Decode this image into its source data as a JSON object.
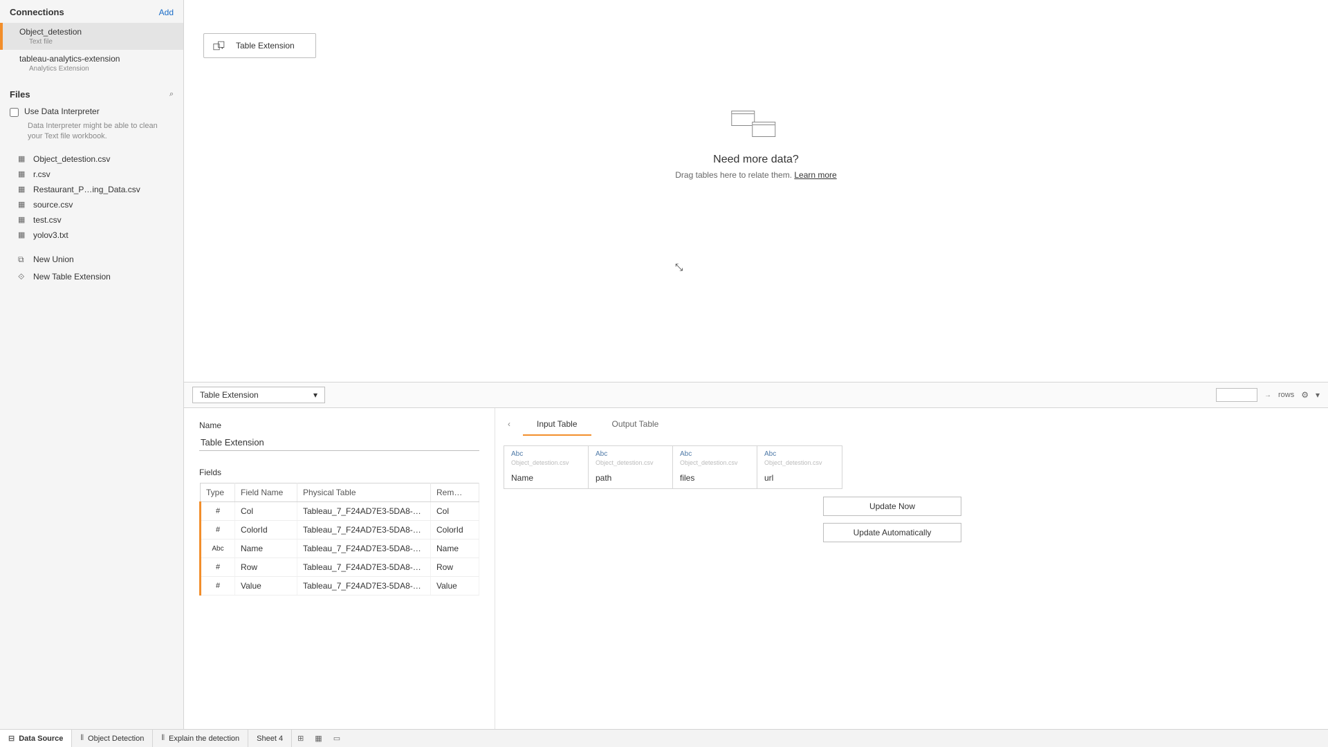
{
  "sidebar": {
    "title": "Connections",
    "add_label": "Add",
    "connections": [
      {
        "name": "Object_detestion",
        "sub": "Text file",
        "active": true
      },
      {
        "name": "tableau-analytics-extension",
        "sub": "Analytics Extension",
        "active": false
      }
    ],
    "files_title": "Files",
    "search_icon_glyph": "⌕",
    "di_label": "Use Data Interpreter",
    "di_hint": "Data Interpreter might be able to clean your Text file workbook.",
    "files": [
      "Object_detestion.csv",
      "r.csv",
      "Restaurant_P…ing_Data.csv",
      "source.csv",
      "test.csv",
      "yolov3.txt"
    ],
    "actions": [
      {
        "icon": "⧉",
        "label": "New Union"
      },
      {
        "icon": "⟐",
        "label": "New Table Extension"
      }
    ]
  },
  "canvas": {
    "pill_label": "Table Extension",
    "placeholder_title": "Need more data?",
    "placeholder_sub": "Drag tables here to relate them. ",
    "placeholder_link": "Learn more"
  },
  "detail": {
    "selector_value": "Table Extension",
    "rows_label": "rows",
    "rows_value": "",
    "name_label": "Name",
    "name_value": "Table Extension",
    "fields_label": "Fields",
    "fields_headers": {
      "type": "Type",
      "field_name": "Field Name",
      "physical": "Physical Table",
      "remote": "Rem…"
    },
    "fields_rows": [
      {
        "type": "hash",
        "field_name": "Col",
        "physical": "Tableau_7_F24AD7E3-5DA8-…",
        "remote": "Col"
      },
      {
        "type": "hash",
        "field_name": "ColorId",
        "physical": "Tableau_7_F24AD7E3-5DA8-…",
        "remote": "ColorId"
      },
      {
        "type": "abc",
        "field_name": "Name",
        "physical": "Tableau_7_F24AD7E3-5DA8-…",
        "remote": "Name"
      },
      {
        "type": "hash",
        "field_name": "Row",
        "physical": "Tableau_7_F24AD7E3-5DA8-…",
        "remote": "Row"
      },
      {
        "type": "hash",
        "field_name": "Value",
        "physical": "Tableau_7_F24AD7E3-5DA8-…",
        "remote": "Value"
      }
    ],
    "tabs": {
      "input": "Input Table",
      "output": "Output Table"
    },
    "io_columns": [
      {
        "type": "Abc",
        "src": "Object_detestion.csv",
        "name": "Name"
      },
      {
        "type": "Abc",
        "src": "Object_detestion.csv",
        "name": "path"
      },
      {
        "type": "Abc",
        "src": "Object_detestion.csv",
        "name": "files"
      },
      {
        "type": "Abc",
        "src": "Object_detestion.csv",
        "name": "url"
      }
    ],
    "update_now": "Update Now",
    "update_auto": "Update Automatically"
  },
  "footer": {
    "tabs": [
      {
        "label": "Data Source",
        "kind": "ds",
        "active": true
      },
      {
        "label": "Object Detection",
        "kind": "sheet"
      },
      {
        "label": "Explain the detection",
        "kind": "sheet"
      },
      {
        "label": "Sheet 4",
        "kind": "sheet"
      }
    ]
  },
  "glyph": {
    "hash": "#",
    "abc": "Abc",
    "dropdown": "▾",
    "chev_left": "‹",
    "search": "⌕",
    "gear": "⚙",
    "chev_down": "▾",
    "arrow_r": "→",
    "grid": "▦",
    "bar": "⫴",
    "cursor": "⤡",
    "new": "⊞"
  }
}
